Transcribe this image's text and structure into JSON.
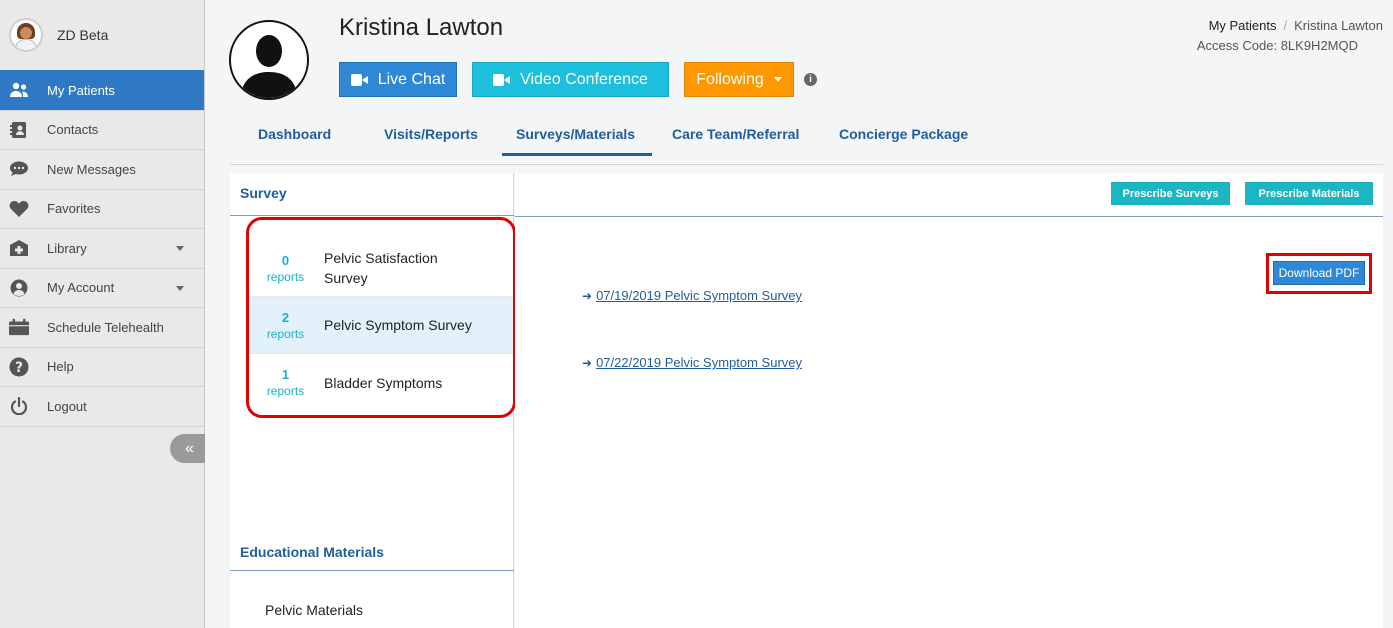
{
  "brand": {
    "name": "ZD Beta"
  },
  "sidebar": {
    "items": [
      {
        "label": "My Patients",
        "icon": "users-icon",
        "active": true
      },
      {
        "label": "Contacts",
        "icon": "address-book-icon"
      },
      {
        "label": "New Messages",
        "icon": "chat-bubble-icon"
      },
      {
        "label": "Favorites",
        "icon": "heart-icon"
      },
      {
        "label": "Library",
        "icon": "library-icon",
        "has_caret": true
      },
      {
        "label": "My Account",
        "icon": "user-circle-icon",
        "has_caret": true
      },
      {
        "label": "Schedule Telehealth",
        "icon": "calendar-icon"
      },
      {
        "label": "Help",
        "icon": "question-icon"
      },
      {
        "label": "Logout",
        "icon": "power-icon"
      }
    ],
    "collapse_glyph": "«"
  },
  "patient": {
    "name": "Kristina Lawton"
  },
  "actions": {
    "live_chat": "Live Chat",
    "video_conference": "Video Conference",
    "following": "Following",
    "info_glyph": "i"
  },
  "breadcrumb": {
    "root": "My Patients",
    "separator": "/",
    "current": "Kristina Lawton",
    "access_code": "Access Code: 8LK9H2MQD"
  },
  "tabs": [
    "Dashboard",
    "Visits/Reports",
    "Surveys/Materials",
    "Care Team/Referral",
    "Concierge Package"
  ],
  "active_tab": "Surveys/Materials",
  "survey": {
    "title": "Survey",
    "items": [
      {
        "count": "0",
        "count_label": "reports",
        "name": "Pelvic Satisfaction Survey"
      },
      {
        "count": "2",
        "count_label": "reports",
        "name": "Pelvic Symptom Survey",
        "selected": true
      },
      {
        "count": "1",
        "count_label": "reports",
        "name": "Bladder Symptoms"
      }
    ]
  },
  "materials": {
    "title": "Educational Materials",
    "items": [
      "Pelvic Materials"
    ]
  },
  "toolbar": {
    "prescribe_surveys": "Prescribe Surveys",
    "prescribe_materials": "Prescribe Materials",
    "download_pdf": "Download PDF"
  },
  "reports": [
    {
      "label": "07/19/2019 Pelvic Symptom Survey"
    },
    {
      "label": "07/22/2019 Pelvic Symptom Survey"
    }
  ],
  "colors": {
    "primary": "#2f88d6",
    "sidebar_active": "#2f79c4",
    "cyan": "#1ebfdc",
    "teal": "#1bb6c1",
    "orange": "#ff9800",
    "link": "#1f5e9e",
    "highlight": "#e00000"
  }
}
